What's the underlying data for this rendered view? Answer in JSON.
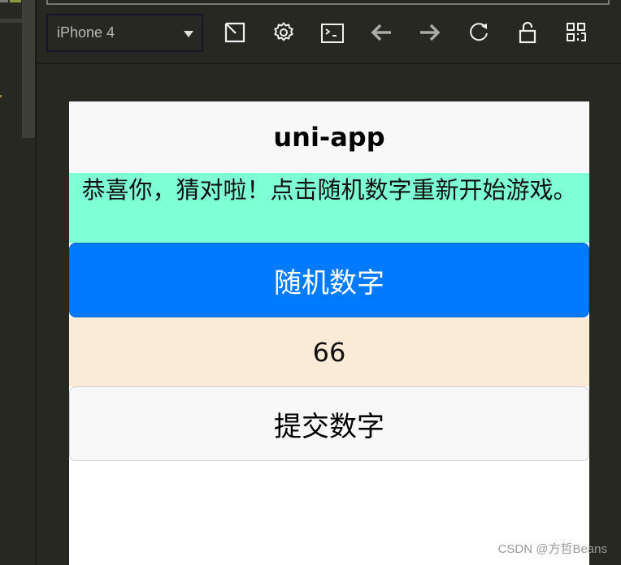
{
  "toolbar": {
    "device_select": {
      "value": "iPhone 4"
    },
    "icons": [
      "expand-icon",
      "gear-icon",
      "terminal-icon",
      "arrow-left-icon",
      "arrow-right-icon",
      "refresh-icon",
      "unlock-icon",
      "qrcode-icon"
    ]
  },
  "app": {
    "nav_title": "uni-app",
    "message": "恭喜你，猜对啦！点击随机数字重新开始游戏。",
    "random_button_label": "随机数字",
    "current_number": "66",
    "submit_button_label": "提交数字"
  },
  "colors": {
    "message_bg": "#7fffd4",
    "primary_button": "#007aff",
    "number_bg": "#faebd7"
  },
  "watermark": "CSDN @方哲Beans"
}
